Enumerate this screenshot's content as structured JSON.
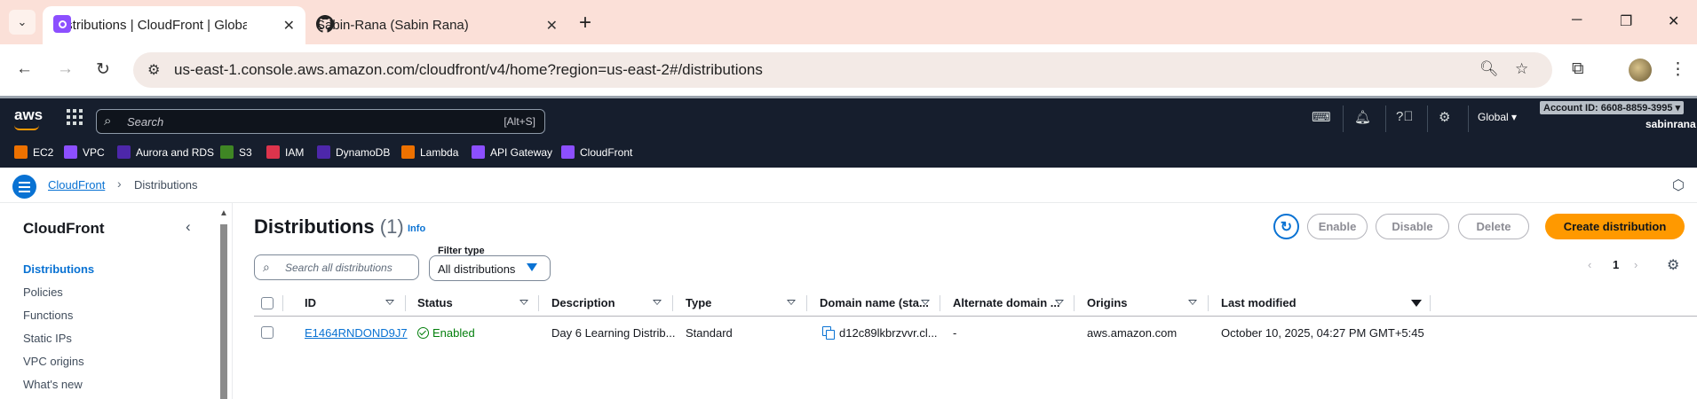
{
  "browser": {
    "tabs": [
      {
        "title": "Distributions | CloudFront | Global",
        "favicon": "cloudfront-favicon",
        "active": true
      },
      {
        "title": "Sabin-Rana (Sabin Rana)",
        "favicon": "github-favicon",
        "active": false
      }
    ],
    "new_tab": "+",
    "url": "us-east-1.console.aws.amazon.com/cloudfront/v4/home?region=us-east-2#/distributions"
  },
  "aws_header": {
    "logo": "aws",
    "search_placeholder": "Search",
    "search_shortcut": "[Alt+S]",
    "region": "Global ▾",
    "account": "Account ID: 6608-8859-3995 ▾",
    "user": "sabinrana",
    "favorites": [
      {
        "label": "EC2",
        "color": "#ed7100"
      },
      {
        "label": "VPC",
        "color": "#8c4fff"
      },
      {
        "label": "Aurora and RDS",
        "color": "#4d27aa"
      },
      {
        "label": "S3",
        "color": "#3f8624"
      },
      {
        "label": "IAM",
        "color": "#dd344c"
      },
      {
        "label": "DynamoDB",
        "color": "#4d27aa"
      },
      {
        "label": "Lambda",
        "color": "#ed7100"
      },
      {
        "label": "API Gateway",
        "color": "#8c4fff"
      },
      {
        "label": "CloudFront",
        "color": "#8c4fff"
      }
    ]
  },
  "breadcrumb": {
    "root": "CloudFront",
    "current": "Distributions"
  },
  "sidebar": {
    "title": "CloudFront",
    "items": [
      {
        "label": "Distributions",
        "active": true
      },
      {
        "label": "Policies"
      },
      {
        "label": "Functions"
      },
      {
        "label": "Static IPs"
      },
      {
        "label": "VPC origins"
      },
      {
        "label": "What's new"
      }
    ]
  },
  "main": {
    "title": "Distributions",
    "count": "(1)",
    "info": "Info",
    "buttons": {
      "enable": "Enable",
      "disable": "Disable",
      "delete": "Delete",
      "create": "Create distribution"
    },
    "search_placeholder": "Search all distributions",
    "filter_type_label": "Filter type",
    "filter_type_value": "All distributions",
    "page": "1",
    "columns": [
      "ID",
      "Status",
      "Description",
      "Type",
      "Domain name (sta...",
      "Alternate domain ...",
      "Origins",
      "Last modified"
    ],
    "rows": [
      {
        "id": "E1464RNDOND9J7",
        "status": "Enabled",
        "description": "Day 6 Learning Distrib...",
        "type": "Standard",
        "domain": "d12c89lkbrzvvr.cl...",
        "alternate": "-",
        "origins": "aws.amazon.com",
        "last_modified": "October 10, 2025, 04:27 PM GMT+5:45"
      }
    ]
  }
}
